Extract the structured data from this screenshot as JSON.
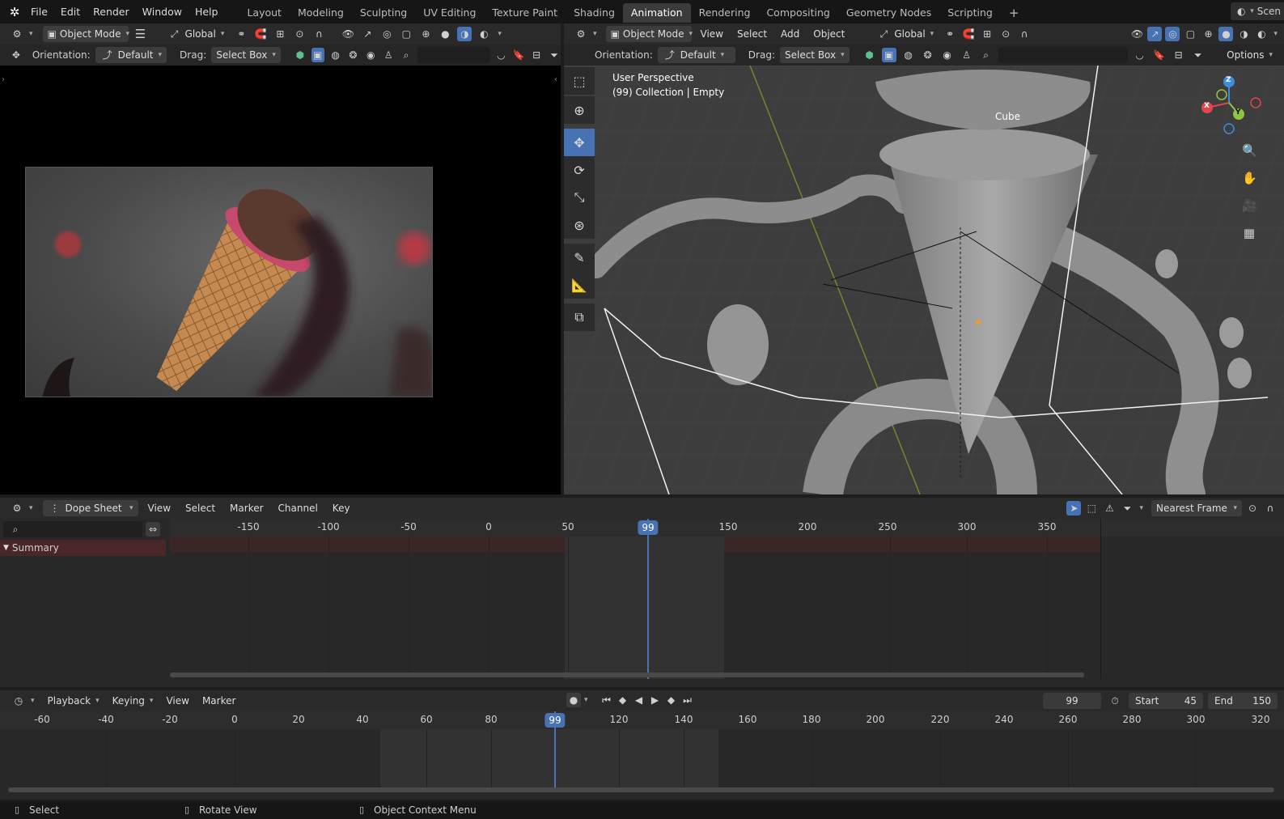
{
  "topbar": {
    "menus": [
      "File",
      "Edit",
      "Render",
      "Window",
      "Help"
    ],
    "workspaces": [
      "Layout",
      "Modeling",
      "Sculpting",
      "UV Editing",
      "Texture Paint",
      "Shading",
      "Animation",
      "Rendering",
      "Compositing",
      "Geometry Nodes",
      "Scripting"
    ],
    "active_workspace": "Animation",
    "add_tab": "+",
    "scene_label": "Scen"
  },
  "left_editor": {
    "mode": "Object Mode",
    "transform_space": "Global",
    "orientation_label": "Orientation:",
    "orientation_value": "Default",
    "drag_label": "Drag:",
    "drag_value": "Select Box"
  },
  "viewport": {
    "mode": "Object Mode",
    "menus": [
      "View",
      "Select",
      "Add",
      "Object"
    ],
    "transform_space": "Global",
    "orientation_label": "Orientation:",
    "orientation_value": "Default",
    "drag_label": "Drag:",
    "drag_value": "Select Box",
    "options_label": "Options",
    "overlay_title": "User Perspective",
    "overlay_subtitle": "(99) Collection | Empty",
    "object_label": "Cube",
    "gizmo_axes": {
      "x": "X",
      "y": "Y",
      "z": "Z"
    },
    "tools": [
      "select-box",
      "cursor",
      "move",
      "rotate",
      "scale",
      "transform",
      "annotate",
      "measure",
      "add-cube"
    ],
    "active_tool": "move"
  },
  "dope_sheet": {
    "editor_type": "Dope Sheet",
    "menus": [
      "View",
      "Select",
      "Marker",
      "Channel",
      "Key"
    ],
    "snap_mode": "Nearest Frame",
    "search_placeholder": "",
    "channel_summary": "Summary",
    "ruler_ticks": [
      "-150",
      "-100",
      "-50",
      "0",
      "50",
      "150",
      "200",
      "250",
      "300",
      "350"
    ],
    "current_frame": "99"
  },
  "timeline": {
    "menus": [
      "Playback",
      "Keying",
      "View",
      "Marker"
    ],
    "current_frame": "99",
    "start_label": "Start",
    "start_value": "45",
    "end_label": "End",
    "end_value": "150",
    "ruler_ticks": [
      "-60",
      "-40",
      "-20",
      "0",
      "20",
      "40",
      "60",
      "80",
      "120",
      "140",
      "160",
      "180",
      "200",
      "220",
      "240",
      "260",
      "280",
      "300",
      "320"
    ],
    "frame_badge": "99"
  },
  "statusbar": {
    "hints": [
      "Select",
      "Rotate View",
      "Object Context Menu"
    ]
  },
  "colors": {
    "accent": "#4772b3",
    "summary_row": "#4a2727",
    "gizmo_x": "#e0464b",
    "gizmo_y": "#8ec63f",
    "gizmo_z": "#3d8ce0"
  }
}
